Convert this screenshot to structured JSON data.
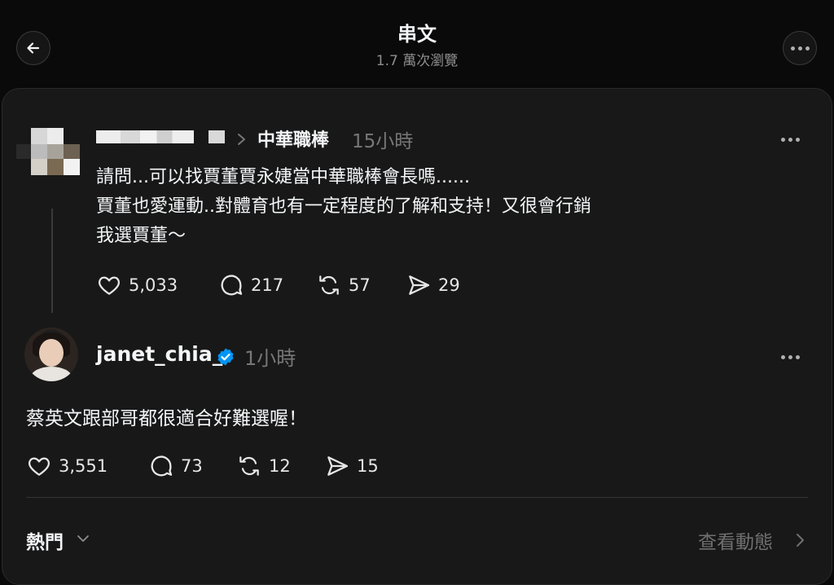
{
  "header": {
    "title": "串文",
    "views": "1.7 萬次瀏覽"
  },
  "post1": {
    "topic": "中華職棒",
    "time": "15小時",
    "lines": [
      "請問...可以找賈董賈永婕當中華職棒會長嗎......",
      "賈董也愛運動..對體育也有一定程度的了解和支持！又很會行銷",
      "我選賈董～"
    ],
    "likes": "5,033",
    "comments": "217",
    "reposts": "57",
    "shares": "29"
  },
  "post2": {
    "username": "janet_chia_",
    "time": "1小時",
    "text": "蔡英文跟部哥都很適合好難選喔！",
    "likes": "3,551",
    "comments": "73",
    "reposts": "12",
    "shares": "15"
  },
  "footer": {
    "sort_label": "熱門",
    "activity_label": "查看動態"
  },
  "icons": {
    "back": "arrow-left-icon",
    "more": "more-horizontal-icon",
    "like": "heart-icon",
    "comment": "comment-icon",
    "repost": "repost-icon",
    "share": "send-icon",
    "verified": "verified-badge-icon"
  },
  "colors": {
    "background": "#0a0a0a",
    "card": "#181818",
    "verified": "#0095f6",
    "muted": "#777777"
  }
}
